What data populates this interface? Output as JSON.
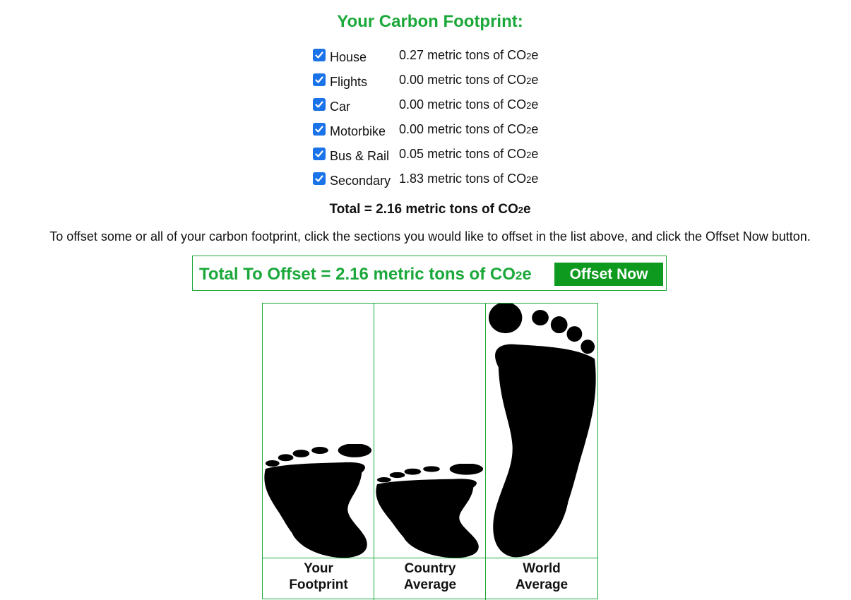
{
  "heading": "Your Carbon Footprint:",
  "unit_prefix": "metric tons of CO",
  "unit_sub": "2",
  "unit_suffix": "e",
  "categories": [
    {
      "label": "House",
      "value": "0.27",
      "checked": true
    },
    {
      "label": "Flights",
      "value": "0.00",
      "checked": true
    },
    {
      "label": "Car",
      "value": "0.00",
      "checked": true
    },
    {
      "label": "Motorbike",
      "value": "0.00",
      "checked": true
    },
    {
      "label": "Bus & Rail",
      "value": "0.05",
      "checked": true
    },
    {
      "label": "Secondary",
      "value": "1.83",
      "checked": true
    }
  ],
  "total": {
    "prefix": "Total = ",
    "value": "2.16"
  },
  "instructions": "To offset some or all of your carbon footprint, click the sections you would like to offset in the list above, and click the Offset Now button.",
  "offset": {
    "prefix": "Total To Offset = ",
    "value": "2.16",
    "button_label": "Offset Now"
  },
  "comparison": [
    {
      "line1": "Your",
      "line2": "Footprint",
      "level": 0.45
    },
    {
      "line1": "Country",
      "line2": "Average",
      "level": 0.37
    },
    {
      "line1": "World",
      "line2": "Average",
      "level": 1.0
    }
  ],
  "colors": {
    "accent_green": "#1ba83a",
    "button_green": "#0e9a1e",
    "checkbox_blue": "#1a73e8"
  }
}
